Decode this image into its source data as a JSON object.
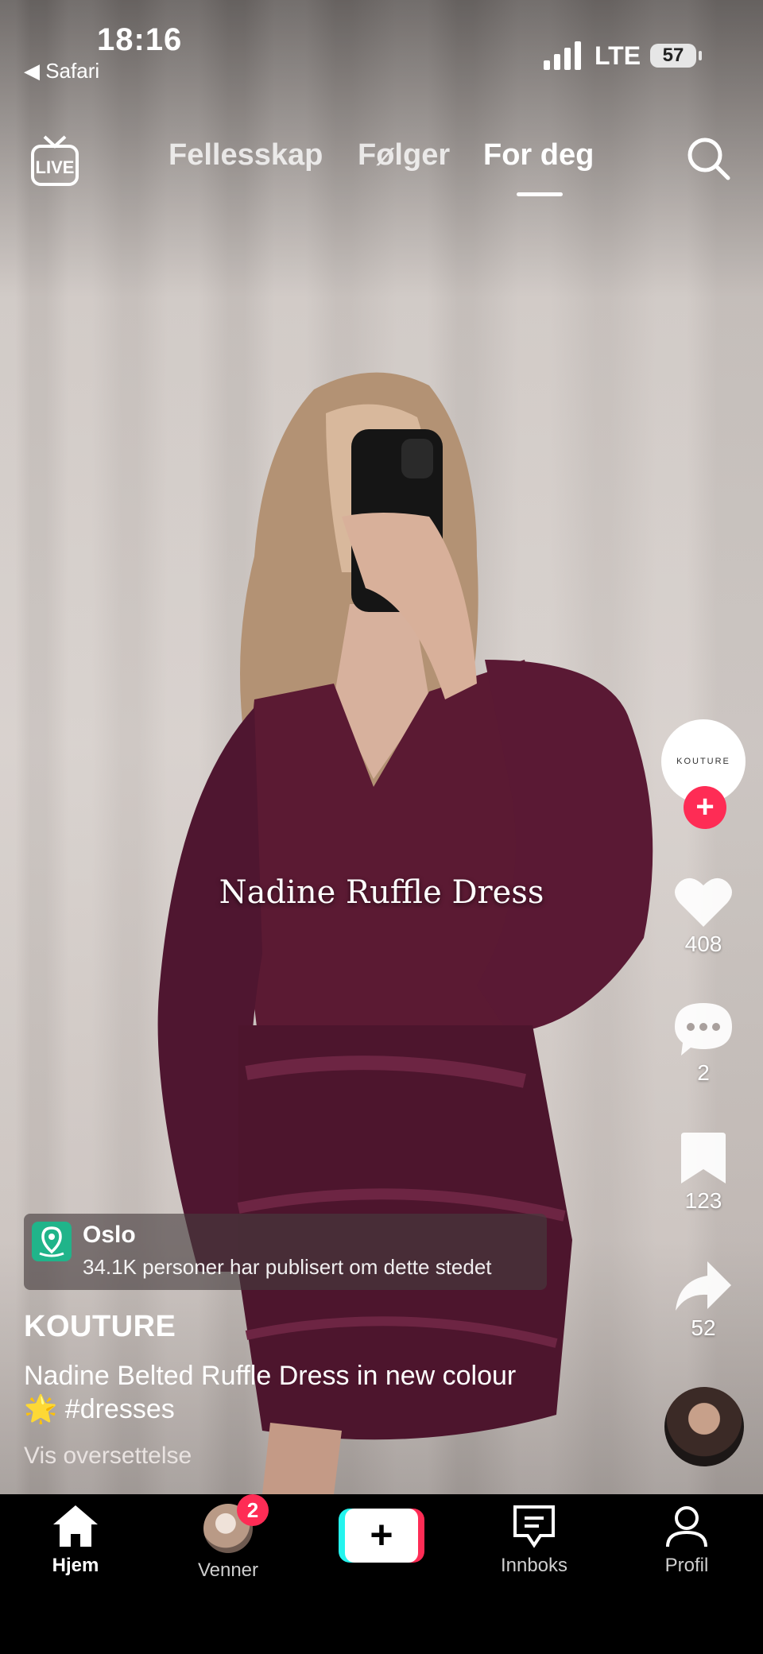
{
  "status_bar": {
    "time": "18:16",
    "back_label": "◀ Safari",
    "network": "LTE",
    "battery": "57"
  },
  "top_nav": {
    "live_icon": "live-tv-icon",
    "tabs": [
      {
        "label": "Fellesskap",
        "active": false
      },
      {
        "label": "Følger",
        "active": false
      },
      {
        "label": "For deg",
        "active": true
      }
    ],
    "search_icon": "search-icon"
  },
  "video": {
    "overlay_text": "Nadine Ruffle Dress"
  },
  "right_actions": {
    "brand_logo_text": "KOUTURE",
    "follow_label": "+",
    "likes": "408",
    "comments": "2",
    "saves": "123",
    "shares": "52"
  },
  "location": {
    "title": "Oslo",
    "subtitle": "34.1K personer har publisert om dette stedet"
  },
  "post": {
    "author": "KOUTURE",
    "caption_line1": "Nadine Belted Ruffle Dress in new colour",
    "caption_line2": "🌟 #dresses",
    "translate_label": "Vis oversettelse"
  },
  "bottom_nav": {
    "home": "Hjem",
    "friends": "Venner",
    "friends_badge": "2",
    "create": "+",
    "inbox": "Innboks",
    "profile": "Profil"
  },
  "colors": {
    "accent_red": "#fe2c55",
    "accent_cyan": "#25f4ee",
    "location_green": "#20b48a",
    "dress": "#5b1a33"
  }
}
